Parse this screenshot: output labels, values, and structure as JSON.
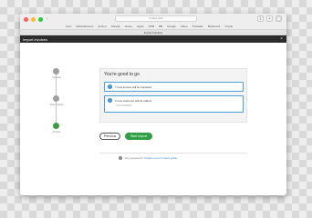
{
  "browser": {
    "address": "in.xero.com",
    "bookmarks": [
      "Xero",
      "Miscellaneous",
      "Anchor",
      "Shopify",
      "Home",
      "Apple",
      "XPM",
      "BB",
      "Google",
      "Video",
      "Translate",
      "Bookmark",
      "Crypto"
    ],
    "tab_title": "Import Invoices",
    "colors": {
      "close": "#fe5f57",
      "minimize": "#febc2e",
      "zoom": "#28c840"
    }
  },
  "modal": {
    "title": "Import invoices",
    "close_label": "×"
  },
  "steps": [
    {
      "label": "Upload",
      "state": "done"
    },
    {
      "label": "Map Fields",
      "state": "done"
    },
    {
      "label": "Import",
      "state": "current"
    }
  ],
  "summary": {
    "title": "You're good to go",
    "notices": [
      {
        "text": "7 new invoice will be imported.",
        "icon": "info-icon"
      },
      {
        "text": "2 new customer will be added.",
        "sub": "• CUSTOMER01",
        "icon": "info-icon"
      }
    ]
  },
  "buttons": {
    "previous": "Previous",
    "start_import": "Start Import"
  },
  "help": {
    "question": "Any questions?",
    "link": "Check out our import guide"
  },
  "colors": {
    "primary_green": "#2f9e44",
    "info_blue": "#3b8fca",
    "header_dark": "#2b2b2b"
  }
}
